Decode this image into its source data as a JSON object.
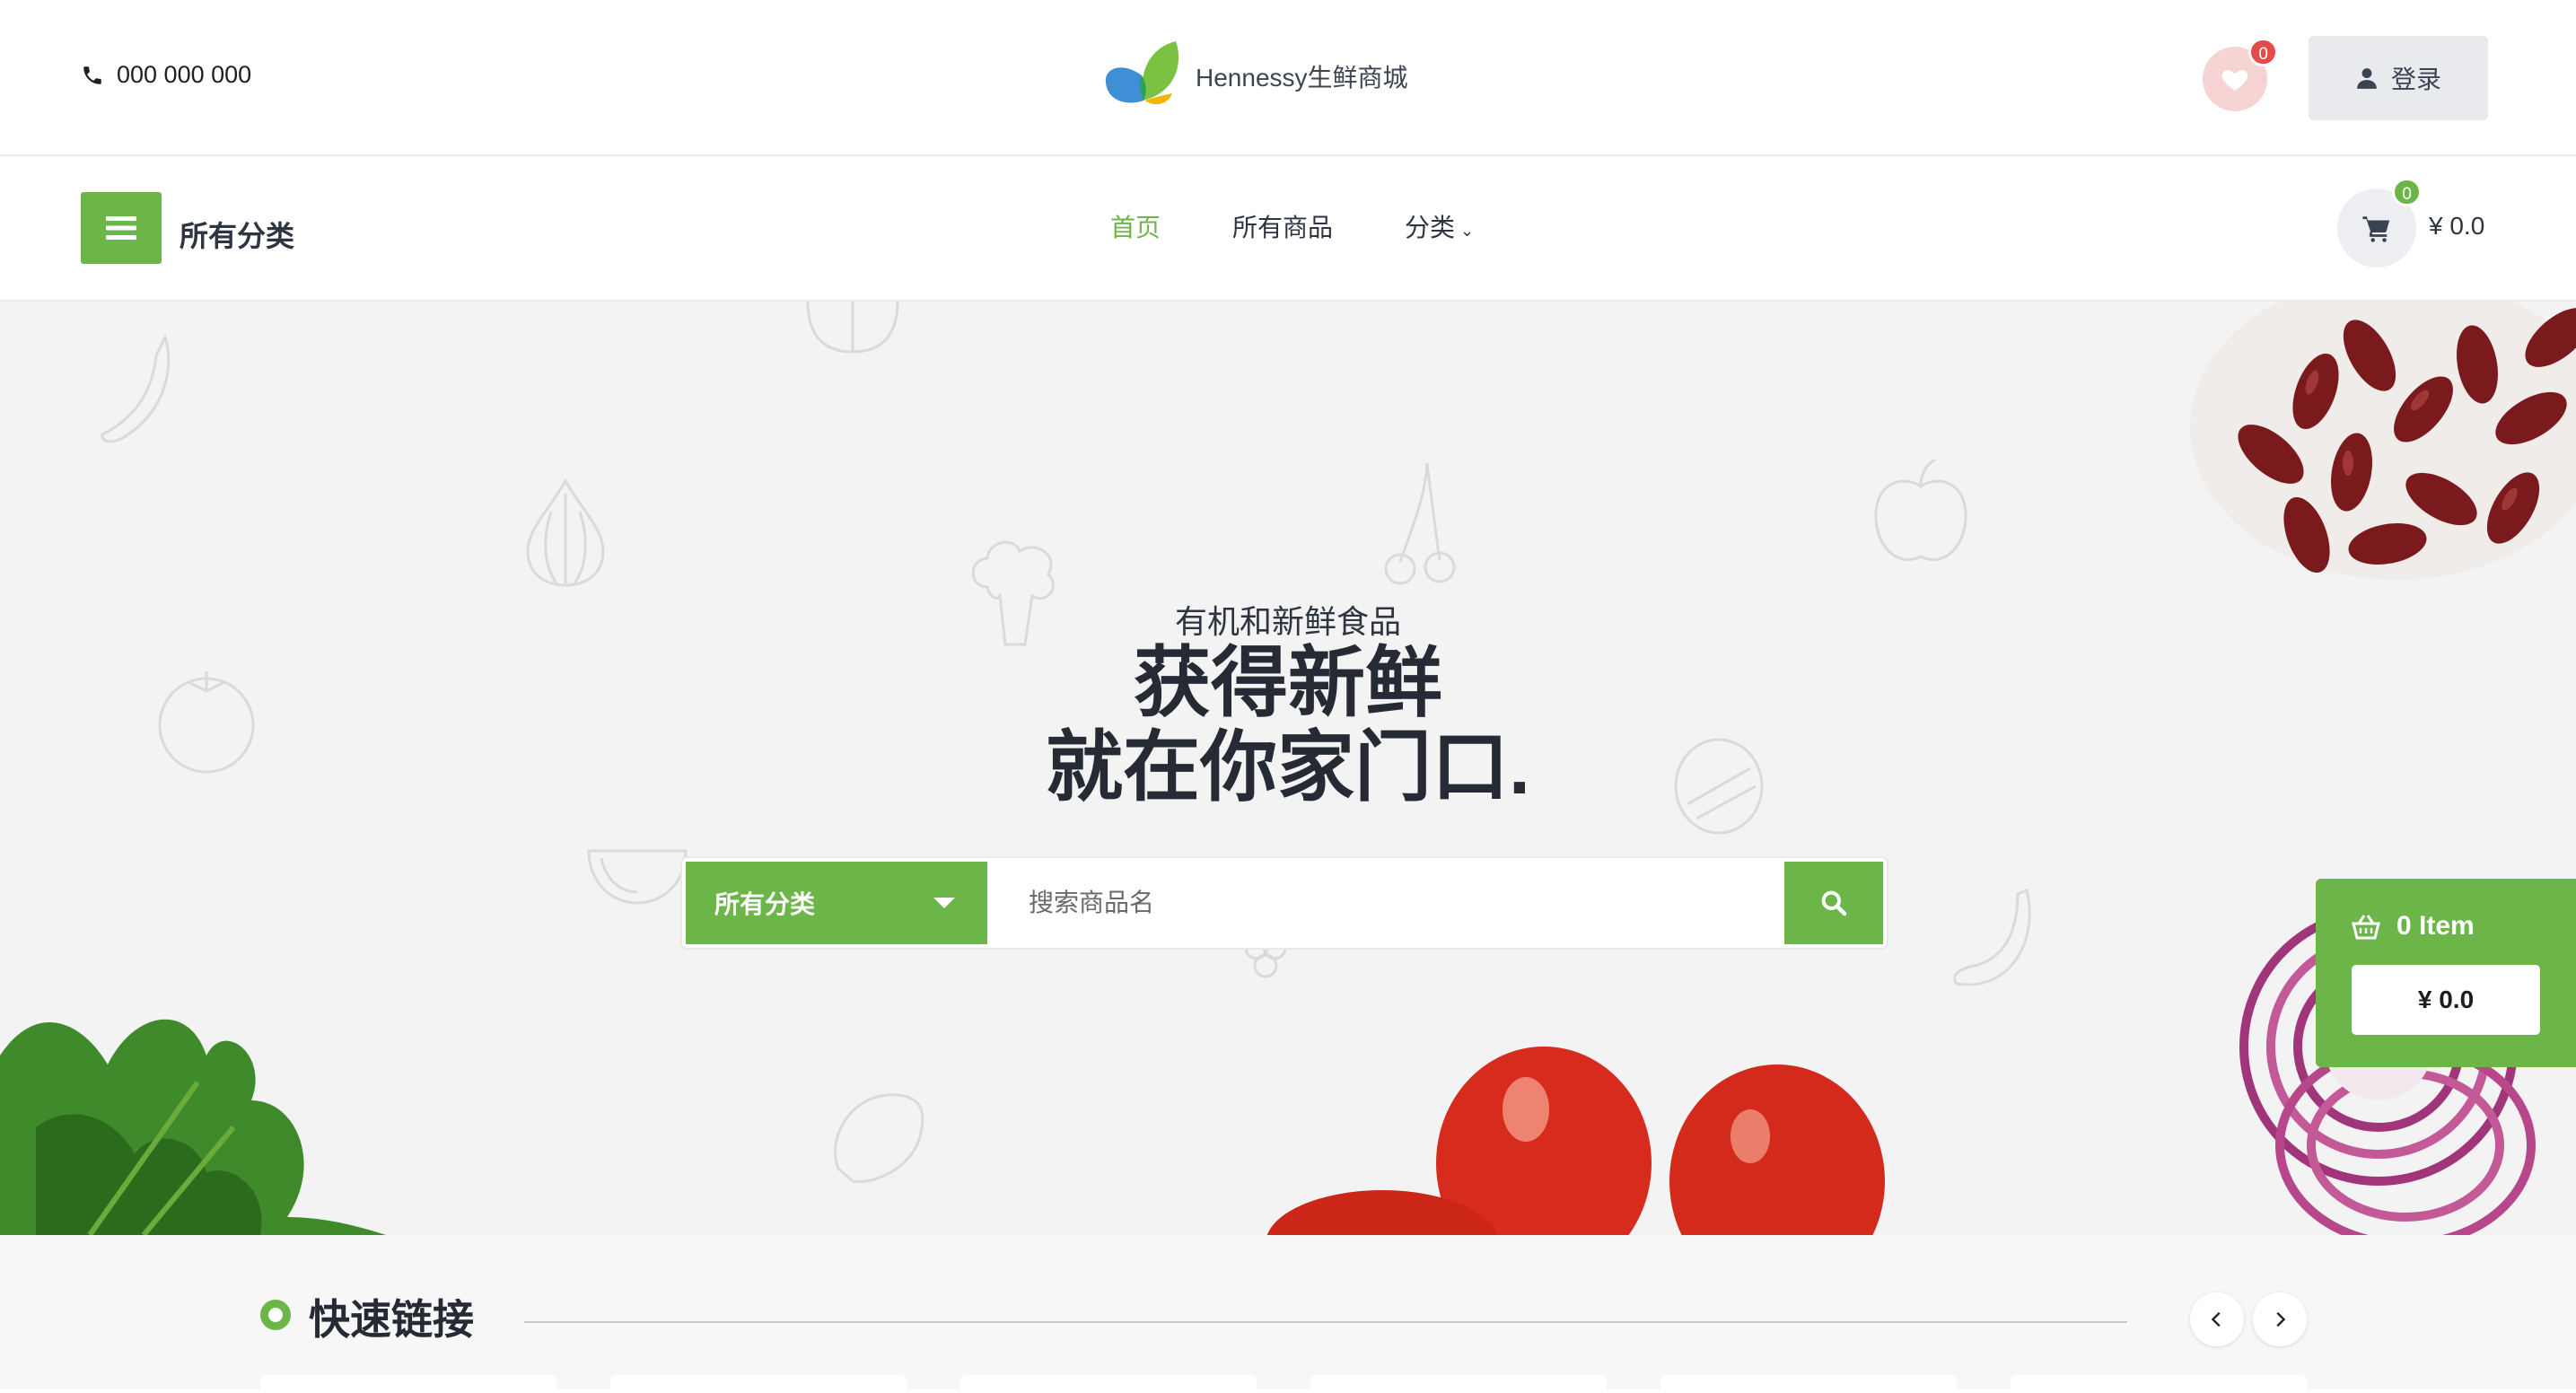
{
  "header": {
    "phone": "000 000 000",
    "brand_name": "Hennessy生鲜商城",
    "wishlist_count": "0",
    "login_label": "登录"
  },
  "nav": {
    "categories_label": "所有分类",
    "links": [
      "首页",
      "所有商品",
      "分类"
    ],
    "cart_count": "0",
    "cart_total": "¥ 0.0"
  },
  "hero": {
    "subtitle": "有机和新鲜食品",
    "title_line1": "获得新鲜",
    "title_line2": "就在你家门口."
  },
  "search": {
    "category": "所有分类",
    "placeholder": "搜索商品名"
  },
  "mini_cart": {
    "items_label": "0 Item",
    "total": "¥ 0.0"
  },
  "quick_links": {
    "title": "快速链接"
  },
  "colors": {
    "accent": "#6cb548",
    "badge_red": "#e44b4b",
    "heading": "#252a34"
  }
}
